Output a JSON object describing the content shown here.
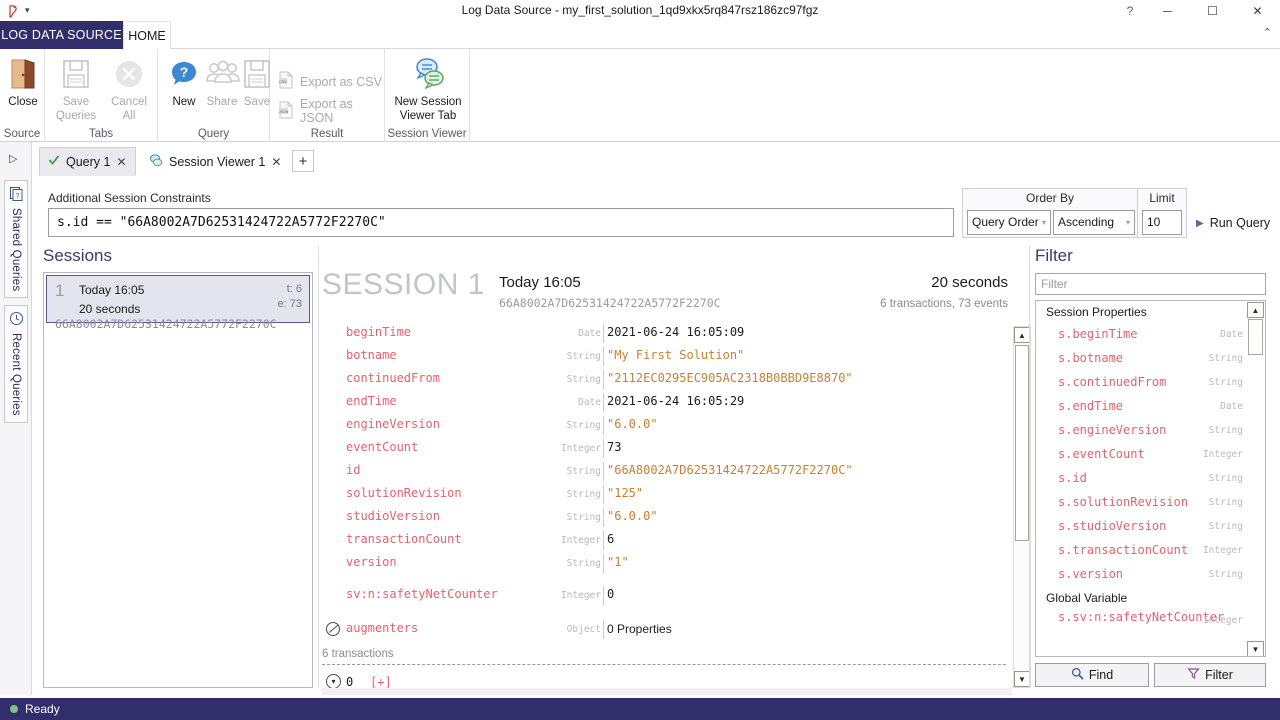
{
  "window": {
    "title": "Log Data Source - my_first_solution_1qd9xkx5rq847rsz186zc97fgz",
    "help_icon": "?",
    "minimize_icon": "─",
    "maximize_icon": "☐",
    "close_icon": "✕",
    "qat_caret": "▾",
    "ribbon_collapse_icon": "⌃"
  },
  "ribbon": {
    "tabs": [
      {
        "label": "LOG DATA SOURCE",
        "name": "file-tab"
      },
      {
        "label": "HOME",
        "name": "home-tab"
      }
    ],
    "groups": [
      {
        "name": "source",
        "label": "Source",
        "buttons": [
          {
            "label": "Close",
            "icon": "door-icon",
            "enabled": true
          }
        ]
      },
      {
        "name": "tabs",
        "label": "Tabs",
        "buttons": [
          {
            "label": "Save\nQueries",
            "line1": "Save",
            "line2": "Queries",
            "icon": "floppy-disk-icon",
            "enabled": false
          },
          {
            "label": "Cancel\nAll",
            "line1": "Cancel",
            "line2": "All",
            "icon": "cancel-circle-icon",
            "enabled": false
          }
        ]
      },
      {
        "name": "query",
        "label": "Query",
        "buttons": [
          {
            "label": "New",
            "icon": "question-bubble-icon",
            "enabled": true
          },
          {
            "label": "Share",
            "icon": "people-icon",
            "enabled": false
          },
          {
            "label": "Save",
            "icon": "floppy-disk-icon",
            "enabled": false
          }
        ]
      },
      {
        "name": "result",
        "label": "Result",
        "buttons": [
          {
            "label": "Export as CSV",
            "icon": "csv-file-icon",
            "enabled": false
          },
          {
            "label": "Export as JSON",
            "icon": "json-file-icon",
            "enabled": false
          }
        ]
      },
      {
        "name": "session-viewer",
        "label": "Session Viewer",
        "buttons": [
          {
            "line1": "New Session",
            "line2": "Viewer Tab",
            "icon": "chat-bubbles-icon",
            "enabled": true
          }
        ]
      }
    ]
  },
  "leftdock": {
    "pin_icon": "▷",
    "tabs": [
      {
        "label": "Shared Queries",
        "icon": "document-question-icon"
      },
      {
        "label": "Recent Queries",
        "icon": "clock-icon"
      }
    ]
  },
  "doctabs": {
    "items": [
      {
        "label": "Query 1",
        "icon": "check-icon",
        "close_icon": "✕",
        "active": true
      },
      {
        "label": "Session Viewer 1",
        "icon": "session-viewer-icon",
        "close_icon": "✕",
        "active": false
      }
    ],
    "add_label": "+"
  },
  "query": {
    "constraints_label": "Additional Session Constraints",
    "constraints_value": "s.id == \"66A8002A7D62531424722A5772F2270C\"",
    "constraints_placeholder": "",
    "order_by_label": "Order By",
    "order_by_value": "Query Order",
    "order_dir_value": "Ascending",
    "limit_label": "Limit",
    "limit_value": "10",
    "run_label": "Run Query",
    "run_icon": "▶",
    "caret_icon": "▾"
  },
  "sessions": {
    "title": "Sessions",
    "items": [
      {
        "number": "1",
        "time": "Today 16:05",
        "duration": "20 seconds",
        "transactions": "t: 6",
        "events": "e: 73",
        "id": "66A8002A7D62531424722A5772F2270C"
      }
    ]
  },
  "detail": {
    "banner_title": "SESSION 1",
    "banner_time": "Today 16:05",
    "banner_id": "66A8002A7D62531424722A5772F2270C",
    "banner_duration": "20 seconds",
    "banner_counts": "6 transactions, 73 events",
    "properties": [
      {
        "key": "beginTime",
        "type": "Date",
        "value": "2021-06-24 16:05:09",
        "string": false
      },
      {
        "key": "botname",
        "type": "String",
        "value": "\"My First Solution\"",
        "string": true
      },
      {
        "key": "continuedFrom",
        "type": "String",
        "value": "\"2112EC0295EC905AC2318B0BBD9E8870\"",
        "string": true
      },
      {
        "key": "endTime",
        "type": "Date",
        "value": "2021-06-24 16:05:29",
        "string": false
      },
      {
        "key": "engineVersion",
        "type": "String",
        "value": "\"6.0.0\"",
        "string": true
      },
      {
        "key": "eventCount",
        "type": "Integer",
        "value": "73",
        "string": false
      },
      {
        "key": "id",
        "type": "String",
        "value": "\"66A8002A7D62531424722A5772F2270C\"",
        "string": true
      },
      {
        "key": "solutionRevision",
        "type": "String",
        "value": "\"125\"",
        "string": true
      },
      {
        "key": "studioVersion",
        "type": "String",
        "value": "\"6.0.0\"",
        "string": true
      },
      {
        "key": "transactionCount",
        "type": "Integer",
        "value": "6",
        "string": false
      },
      {
        "key": "version",
        "type": "String",
        "value": "\"1\"",
        "string": true
      }
    ],
    "global_properties": [
      {
        "key": "sv:n:safetyNetCounter",
        "type": "Integer",
        "value": "0",
        "string": false
      }
    ],
    "object_row": {
      "key": "augmenters",
      "type": "Object",
      "value": "0 Properties",
      "icon": "no-entry-icon"
    },
    "transactions_label": "6 transactions",
    "transaction_row": {
      "expand_icon": "▾",
      "index": "0",
      "tag": "[+]"
    }
  },
  "filter": {
    "title": "Filter",
    "input_placeholder": "Filter",
    "input_value": "",
    "groups": [
      {
        "heading": "Session Properties",
        "rows": [
          {
            "key": "s.beginTime",
            "type": "Date"
          },
          {
            "key": "s.botname",
            "type": "String"
          },
          {
            "key": "s.continuedFrom",
            "type": "String"
          },
          {
            "key": "s.endTime",
            "type": "Date"
          },
          {
            "key": "s.engineVersion",
            "type": "String"
          },
          {
            "key": "s.eventCount",
            "type": "Integer"
          },
          {
            "key": "s.id",
            "type": "String"
          },
          {
            "key": "s.solutionRevision",
            "type": "String"
          },
          {
            "key": "s.studioVersion",
            "type": "String"
          },
          {
            "key": "s.transactionCount",
            "type": "Integer"
          },
          {
            "key": "s.version",
            "type": "String"
          }
        ]
      },
      {
        "heading": "Global Variable",
        "rows": [
          {
            "key": "s.sv:n:safetyNetCounter",
            "type": "Integer",
            "wrap": true
          }
        ]
      }
    ],
    "find_button": "Find",
    "find_icon": "search-icon",
    "filter_button": "Filter",
    "filter_icon": "funnel-icon",
    "scroll_up_icon": "▲",
    "scroll_down_icon": "▼"
  },
  "statusbar": {
    "text": "Ready",
    "indicator_color": "#7bc47f"
  },
  "colors": {
    "brand_purple": "#312e6b",
    "key_red": "#e4626f",
    "string_orange": "#c88030",
    "type_gray": "#b8b8c2",
    "heading_blue": "#3b3b6b"
  }
}
